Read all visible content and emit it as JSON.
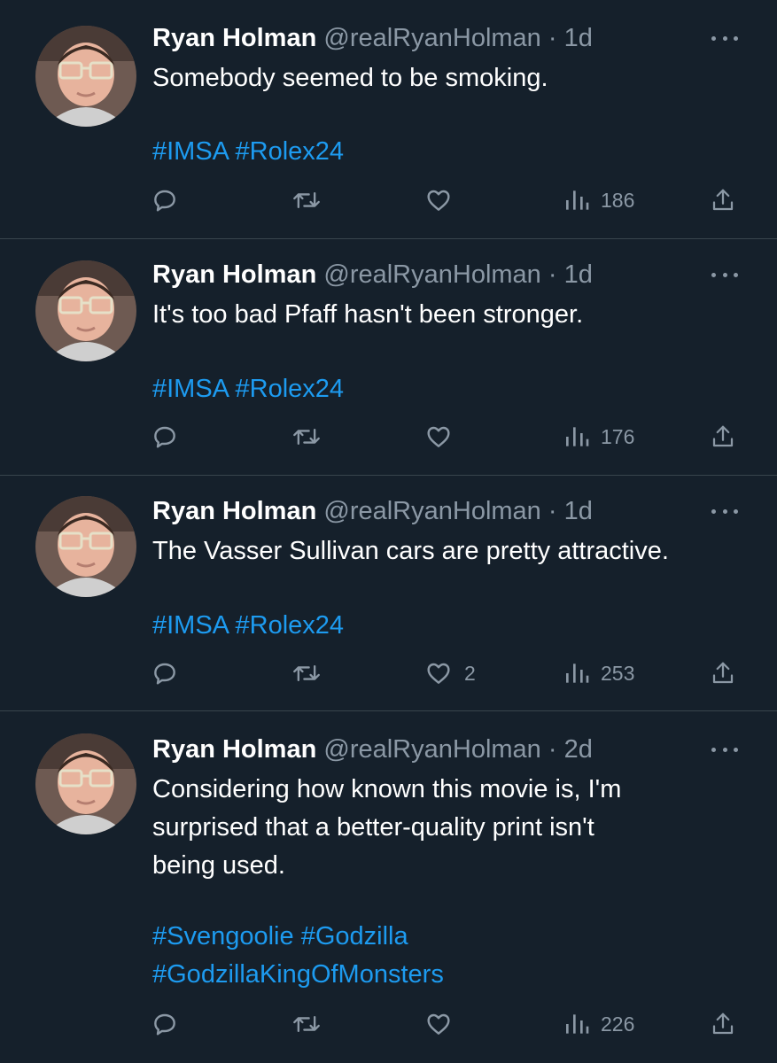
{
  "tweets": [
    {
      "name": "Ryan Holman",
      "handle": "@realRyanHolman",
      "sep": " · ",
      "time": "1d",
      "text": "Somebody seemed to be smoking.",
      "hashtags": [
        "#IMSA",
        "#Rolex24"
      ],
      "likes": "",
      "views": "186"
    },
    {
      "name": "Ryan Holman",
      "handle": "@realRyanHolman",
      "sep": " · ",
      "time": "1d",
      "text": "It's too bad Pfaff hasn't been stronger.",
      "hashtags": [
        "#IMSA",
        "#Rolex24"
      ],
      "likes": "",
      "views": "176"
    },
    {
      "name": "Ryan Holman",
      "handle": "@realRyanHolman",
      "sep": " · ",
      "time": "1d",
      "text": "The Vasser Sullivan cars are pretty attractive.",
      "hashtags": [
        "#IMSA",
        "#Rolex24"
      ],
      "likes": "2",
      "views": "253"
    },
    {
      "name": "Ryan Holman",
      "handle": "@realRyanHolman",
      "sep": " · ",
      "time": "2d",
      "text": "Considering how known this movie is, I'm\nsurprised that a better-quality print isn't\nbeing used.",
      "hashtags": [
        "#Svengoolie",
        "#Godzilla",
        "#GodzillaKingOfMonsters"
      ],
      "likes": "",
      "views": "226"
    }
  ],
  "icons": {
    "reply": "reply-icon",
    "retweet": "retweet-icon",
    "like": "heart-icon",
    "views": "views-icon",
    "share": "share-icon",
    "more": "more-icon"
  },
  "colors": {
    "background": "#15202b",
    "text": "#ffffff",
    "secondary": "#8b98a5",
    "link": "#1d9bf0",
    "divider": "#38444d"
  }
}
